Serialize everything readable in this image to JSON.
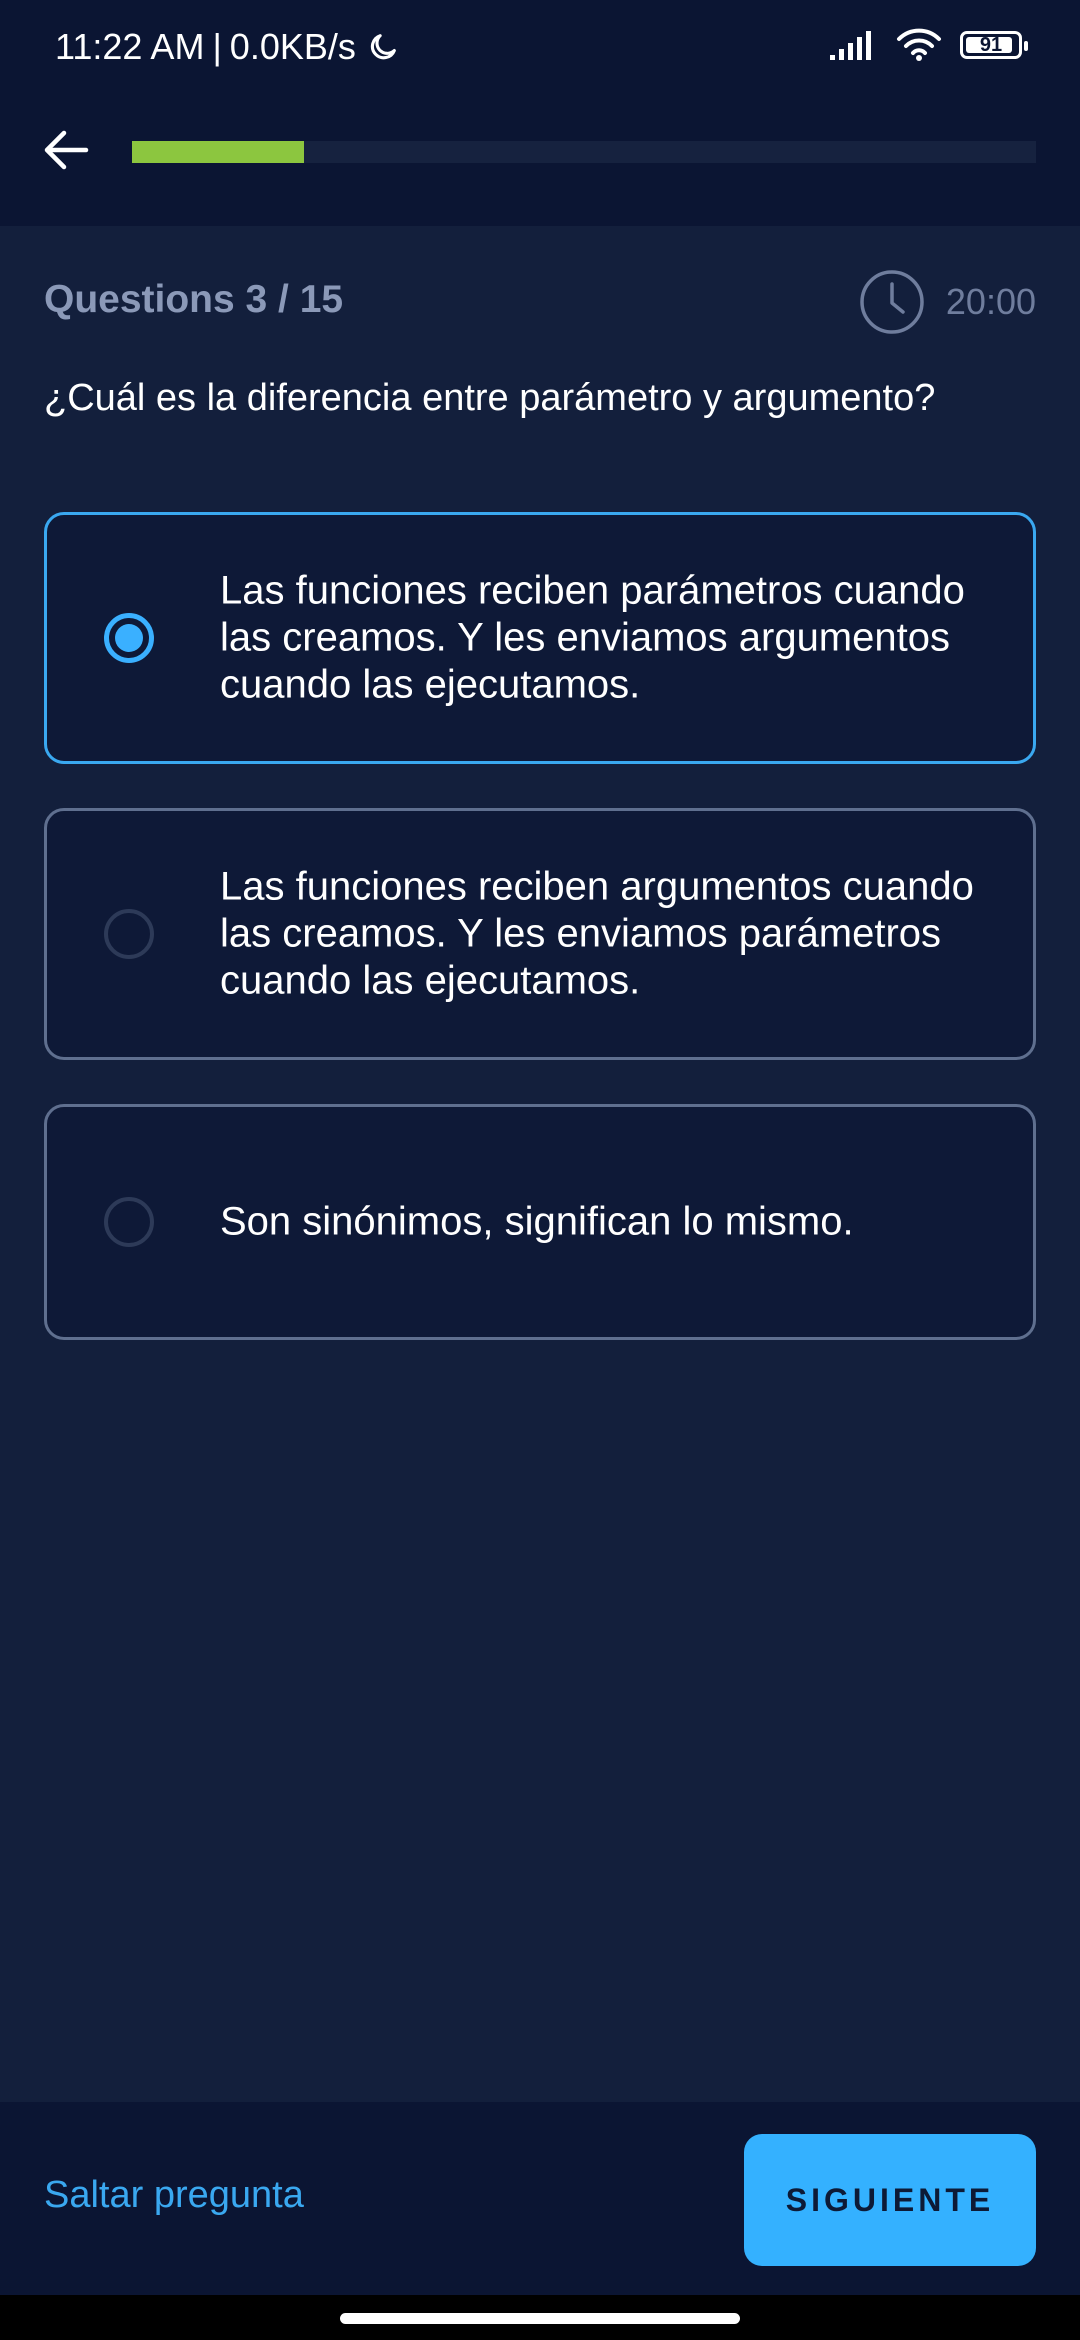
{
  "status_bar": {
    "time": "11:22 AM",
    "separator": "|",
    "network_speed": "0.0KB/s",
    "battery": "91",
    "icons": [
      "moon-icon",
      "signal-icon",
      "wifi-icon",
      "battery-icon"
    ]
  },
  "header": {
    "back_icon": "arrow-left-icon",
    "progress": 0.19,
    "progress_color": "#8cc63f"
  },
  "quiz": {
    "question_count": "Questions 3 / 15",
    "timer": "20:00",
    "timer_icon": "clock-icon",
    "question": "¿Cuál es la diferencia entre parámetro y argumento?",
    "options": [
      {
        "text": "Las funciones reciben parámetros cuando las creamos. Y les enviamos argumentos cuando las ejecutamos.",
        "selected": true
      },
      {
        "text": "Las funciones reciben argumentos cuando las creamos. Y les enviamos parámetros cuando las ejecutamos.",
        "selected": false
      },
      {
        "text": "Son sinónimos, significan lo mismo.",
        "selected": false
      }
    ]
  },
  "footer": {
    "skip_label": "Saltar pregunta",
    "next_label": "SIGUIENTE"
  },
  "colors": {
    "background": "#131f3c",
    "header_background": "#0b1533",
    "accent": "#34b1ff",
    "selected_border": "#3aa8f0",
    "progress": "#8cc63f"
  }
}
